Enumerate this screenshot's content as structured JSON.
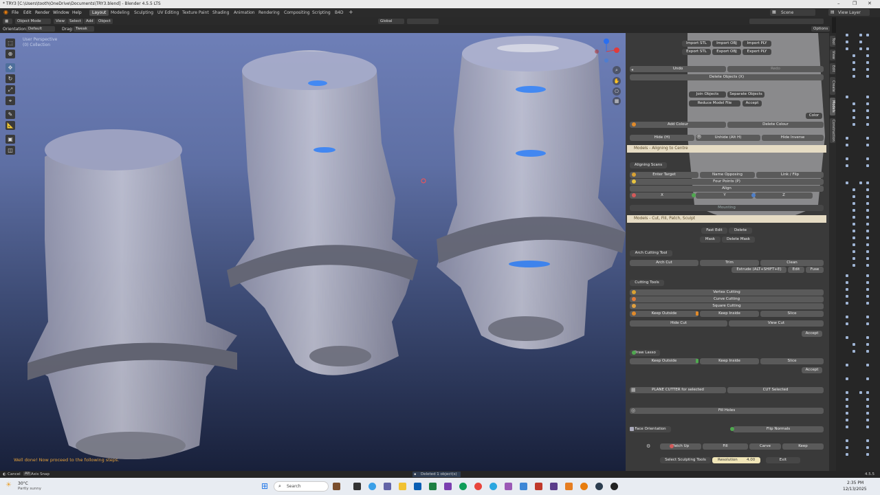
{
  "titlebar": {
    "title": "* TRY3 [C:\\Users\\tooth\\OneDrive\\Documents\\TRY3.blend] - Blender 4.5.5 LTS"
  },
  "menu": [
    "File",
    "Edit",
    "Render",
    "Window",
    "Help"
  ],
  "workspaces": [
    "Layout",
    "Modeling",
    "Sculpting",
    "UV Editing",
    "Texture Paint",
    "Shading",
    "Animation",
    "Rendering",
    "Compositing",
    "Scripting",
    "B4D"
  ],
  "top_right": {
    "scene_label": "Scene",
    "view_layer_label": "View Layer"
  },
  "header": {
    "mode": "Object Mode",
    "view": "View",
    "select": "Select",
    "add": "Add",
    "object": "Object",
    "transform": "Global",
    "orientation_label": "Orientation:",
    "orientation_value": "Default",
    "drag_label": "Drag:",
    "drag_value": "Tweak",
    "options": "Options"
  },
  "viewport": {
    "overlay_line1": "User Perspective",
    "overlay_line2": "(0) Collection",
    "message": "Well done! Now proceed to the following steps."
  },
  "panel": {
    "import_stl": "Import STL",
    "import_obj": "Import OBJ",
    "import_ply": "Import PLY",
    "export_stl": "Export STL",
    "export_obj": "Export OBJ",
    "export_ply": "Export PLY",
    "undo": "Undo",
    "redo": "Redo",
    "delete_objects": "Delete Objects (X)",
    "join_objects": "Join Objects",
    "separate_objects": "Separate Objects",
    "reduce_model_file": "Reduce Model File",
    "accept": "Accept",
    "color": "Color",
    "add_colour": "Add Colour",
    "delete_colour": "Delete Colour",
    "hide": "Hide (H)",
    "unhide": "Unhide (Alt H)",
    "hide_inverse": "Hide Inverse",
    "section1": "Models - Aligning to Centre",
    "aligning_scans": "Aligning Scans",
    "enter_target": "Enter Target",
    "name_opposing": "Name Opposing",
    "link_flip": "Link / Flip",
    "four_points": "Four Points (P)",
    "align": "Align",
    "x": "X",
    "y": "Y",
    "z": "Z",
    "mounting": "Mounting",
    "section2": "Models - Cut, Fill, Patch, Sculpt",
    "fast_edit": "Fast Edit",
    "delete": "Delete",
    "mask": "Mask",
    "delete_mask": "Delete Mask",
    "arch_cutting_tool": "Arch Cutting Tool",
    "arch_cut": "Arch Cut",
    "trim": "Trim",
    "clean": "Clean",
    "extrude": "Extrude (ALT+SHIFT+E)",
    "edit": "Edit",
    "fuse": "Fuse",
    "cutting_tools": "Cutting Tools",
    "vertex_cutting": "Vertex Cutting",
    "curve_cutting": "Curve Cutting",
    "square_cutting": "Square Cutting",
    "keep_outside": "Keep Outside",
    "keep_inside": "Keep Inside",
    "slice": "Slice",
    "hide_cut": "Hide Cut",
    "view_cut": "View Cut",
    "accept2": "Accept",
    "draw_lasso": "Draw Lasso",
    "keep_outside2": "Keep Outside",
    "keep_inside2": "Keep Inside",
    "slice2": "Slice",
    "accept3": "Accept",
    "plane_cutter": "PLANE CUTTER for selected",
    "cut_selected": "CUT Selected",
    "fill_holes": "Fill Holes",
    "face_orientation": "Face Orientation",
    "flip_normals": "Flip Normals",
    "patch_up": "Patch Up",
    "fill": "Fill",
    "carve": "Carve",
    "keep": "Keep",
    "select_sculpting_tools": "Select Sculpting Tools",
    "resolution_label": "Resolution",
    "resolution_value": "4.00",
    "exit": "Exit"
  },
  "vtabs": [
    "Tool",
    "View",
    "Edit",
    "Create",
    "Models",
    "Construction"
  ],
  "statusbar": {
    "cancel": "Cancel",
    "axis_snap": "Axis Snap",
    "alt": "Alt",
    "center_msg": "Deleted 1 object(s)",
    "version": "4.5.5"
  },
  "taskbar": {
    "weather_temp": "30°C",
    "weather_desc": "Partly sunny",
    "search": "Search",
    "time": "2:35 PM",
    "date": "12/13/2025"
  },
  "colors": {
    "accent": "#4b7bbf",
    "section_bg": "#e6dcc4",
    "panel_bg": "#3a3a3a"
  }
}
